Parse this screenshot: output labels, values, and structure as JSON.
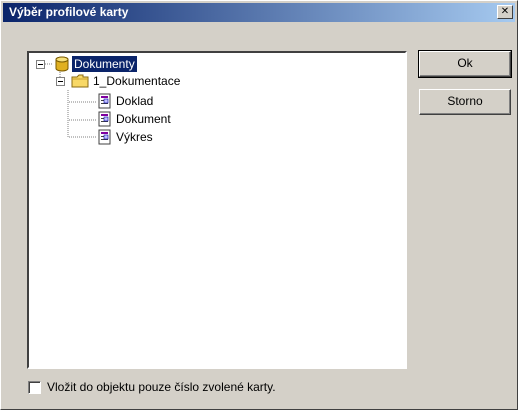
{
  "window": {
    "title": "Výběr profilové karty",
    "close_symbol": "✕"
  },
  "tree": {
    "nodes": [
      {
        "label": "Dokumenty",
        "icon": "database-cylinder-icon",
        "level": 0,
        "expanded": true,
        "selected": true
      },
      {
        "label": "1_Dokumentace",
        "icon": "folder-icon",
        "level": 1,
        "expanded": true,
        "selected": false
      },
      {
        "label": "Doklad",
        "icon": "document-form-icon",
        "level": 2,
        "selected": false
      },
      {
        "label": "Dokument",
        "icon": "document-form-icon",
        "level": 2,
        "selected": false
      },
      {
        "label": "Výkres",
        "icon": "document-form-icon",
        "level": 2,
        "selected": false
      }
    ]
  },
  "buttons": {
    "ok_label": "Ok",
    "cancel_label": "Storno"
  },
  "options": {
    "checkbox_label": "Vložit do objektu pouze číslo zvolené karty.",
    "checkbox_checked": false
  },
  "colors": {
    "titlebar_start": "#0a246a",
    "titlebar_end": "#a6caf0",
    "face": "#d4d0c8",
    "selection": "#0a246a"
  }
}
